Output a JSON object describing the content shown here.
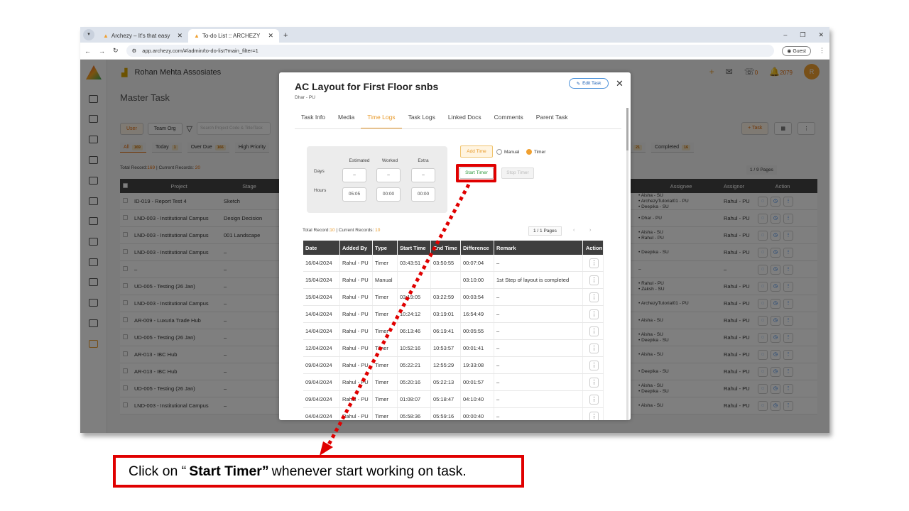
{
  "browser": {
    "tabs": [
      {
        "label": "Archezy – It's that easy"
      },
      {
        "label": "To-do List :: ARCHEZY"
      }
    ],
    "url": "app.archezy.com/#/admin/to-do-list?main_filter=1",
    "guest_label": "Guest"
  },
  "app": {
    "company": "Rohan Mehta Assosiates",
    "page_title": "Master Task",
    "notif_count": "2079",
    "avatar_initial": "R",
    "bell_count": "0",
    "filters": {
      "user": "User",
      "team": "Team",
      "org": "Org",
      "search_placeholder": "Search Project Code & Title/Task"
    },
    "chips": [
      {
        "label": "All",
        "count": "169"
      },
      {
        "label": "Today",
        "count": "1"
      },
      {
        "label": "Over Due",
        "count": "166"
      },
      {
        "label": "High Priority",
        "count": ""
      }
    ],
    "right_chips": [
      {
        "label": "",
        "count": "21"
      },
      {
        "label": "Completed",
        "count": "16"
      }
    ],
    "task_btn": "+ Task",
    "total_prefix": "Total Record:",
    "total_records": "169",
    "current_prefix": " | Current Records: ",
    "current_records": "20",
    "pages": "1 / 9 Pages",
    "table_headers": {
      "project": "Project",
      "stage": "Stage",
      "assignee": "Assignee",
      "assignor": "Assignor",
      "action": "Action"
    },
    "rows": [
      {
        "project": "ID-019 - Report Test 4",
        "stage": "Sketch",
        "assignee": "• Aisha - SU\n• ArchezyTutorial01 - PU\n• Deepika - SU",
        "assignor": "Rahul - PU"
      },
      {
        "project": "LND-003 - Institutional Campus",
        "stage": "Design Decision",
        "assignee": "• Dhar - PU",
        "assignor": "Rahul - PU"
      },
      {
        "project": "LND-003 - Institutional Campus",
        "stage": "001 Landscape",
        "assignee": "• Aisha - SU\n• Rahul - PU",
        "assignor": "Rahul - PU"
      },
      {
        "project": "LND-003 - Institutional Campus",
        "stage": "–",
        "assignee": "• Deepika - SU",
        "assignor": "Rahul - PU"
      },
      {
        "project": "–",
        "stage": "–",
        "assignee": "–",
        "assignor": "–"
      },
      {
        "project": "UD-005 - Testing (26 Jan)",
        "stage": "–",
        "assignee": "• Rahul - PU\n• Zaksh - SU",
        "assignor": "Rahul - PU"
      },
      {
        "project": "LND-003 - Institutional Campus",
        "stage": "–",
        "assignee": "• ArchezyTutorial01 - PU",
        "assignor": "Rahul - PU"
      },
      {
        "project": "AR-009 - Luxuria Trade Hub",
        "stage": "–",
        "assignee": "• Aisha - SU",
        "assignor": "Rahul - PU"
      },
      {
        "project": "UD-005 - Testing (26 Jan)",
        "stage": "–",
        "assignee": "• Aisha - SU\n• Deepika - SU",
        "assignor": "Rahul - PU"
      },
      {
        "project": "AR-013 - IBC Hub",
        "stage": "–",
        "assignee": "• Aisha - SU",
        "assignor": "Rahul - PU"
      },
      {
        "project": "AR-013 - IBC Hub",
        "stage": "–",
        "assignee": "• Deepika - SU",
        "assignor": "Rahul - PU"
      },
      {
        "project": "UD-005 - Testing (26 Jan)",
        "stage": "–",
        "assignee": "• Aisha - SU\n• Deepika - SU",
        "assignor": "Rahul - PU"
      },
      {
        "project": "LND-003 - Institutional Campus",
        "stage": "–",
        "assignee": "• Aisha - SU",
        "assignor": "Rahul - PU"
      }
    ]
  },
  "modal": {
    "title": "AC Layout for First Floor snbs",
    "subtitle": "Dhar - PU",
    "edit_label": "Edit Task",
    "tabs": [
      "Task Info",
      "Media",
      "Time Logs",
      "Task Logs",
      "Linked Docs",
      "Comments",
      "Parent Task"
    ],
    "active_tab": "Time Logs",
    "timebox": {
      "headers": [
        "Estimated",
        "Worked",
        "Extra"
      ],
      "days_label": "Days",
      "hours_label": "Hours",
      "days": [
        "–",
        "–",
        "–"
      ],
      "hours": [
        "05:05",
        "00:00",
        "00:00"
      ]
    },
    "add_time": "Add Time",
    "manual": "Manual",
    "timer": "Timer",
    "start_timer": "Start Timer",
    "stop_timer": "Stop Timer",
    "total_prefix": "Total Record:",
    "total_records": "10",
    "current_prefix": " | Current Records: ",
    "current_records": "10",
    "pages": "1 / 1 Pages",
    "columns": [
      "Date",
      "Added By",
      "Type",
      "Start Time",
      "End Time",
      "Difference",
      "Remark",
      "Action"
    ],
    "logs": [
      {
        "date": "16/04/2024",
        "by": "Rahul - PU",
        "type": "Timer",
        "start": "03:43:51",
        "end": "03:50:55",
        "diff": "00:07:04",
        "remark": "–"
      },
      {
        "date": "15/04/2024",
        "by": "Rahul - PU",
        "type": "Manual",
        "start": "",
        "end": "",
        "diff": "03:10:00",
        "remark": "1st Step of layout is completed"
      },
      {
        "date": "15/04/2024",
        "by": "Rahul - PU",
        "type": "Timer",
        "start": "03:19:05",
        "end": "03:22:59",
        "diff": "00:03:54",
        "remark": "–"
      },
      {
        "date": "14/04/2024",
        "by": "Rahul - PU",
        "type": "Timer",
        "start": "10:24:12",
        "end": "03:19:01",
        "diff": "16:54:49",
        "remark": "–"
      },
      {
        "date": "14/04/2024",
        "by": "Rahul - PU",
        "type": "Timer",
        "start": "06:13:46",
        "end": "06:19:41",
        "diff": "00:05:55",
        "remark": "–"
      },
      {
        "date": "12/04/2024",
        "by": "Rahul - PU",
        "type": "Timer",
        "start": "10:52:16",
        "end": "10:53:57",
        "diff": "00:01:41",
        "remark": "–"
      },
      {
        "date": "09/04/2024",
        "by": "Rahul - PU",
        "type": "Timer",
        "start": "05:22:21",
        "end": "12:55:29",
        "diff": "19:33:08",
        "remark": "–"
      },
      {
        "date": "09/04/2024",
        "by": "Rahul - PU",
        "type": "Timer",
        "start": "05:20:16",
        "end": "05:22:13",
        "diff": "00:01:57",
        "remark": "–"
      },
      {
        "date": "09/04/2024",
        "by": "Rahul - PU",
        "type": "Timer",
        "start": "01:08:07",
        "end": "05:18:47",
        "diff": "04:10:40",
        "remark": "–"
      },
      {
        "date": "04/04/2024",
        "by": "Rahul - PU",
        "type": "Timer",
        "start": "05:58:36",
        "end": "05:59:16",
        "diff": "00:00:40",
        "remark": "–"
      }
    ]
  },
  "callout": {
    "pre": "Click on “",
    "bold": "Start Timer”",
    "post": " whenever start working on task."
  },
  "colors": {
    "accent": "#e89a2b",
    "highlight": "#e00000",
    "header_dark": "#3e3e3e"
  }
}
